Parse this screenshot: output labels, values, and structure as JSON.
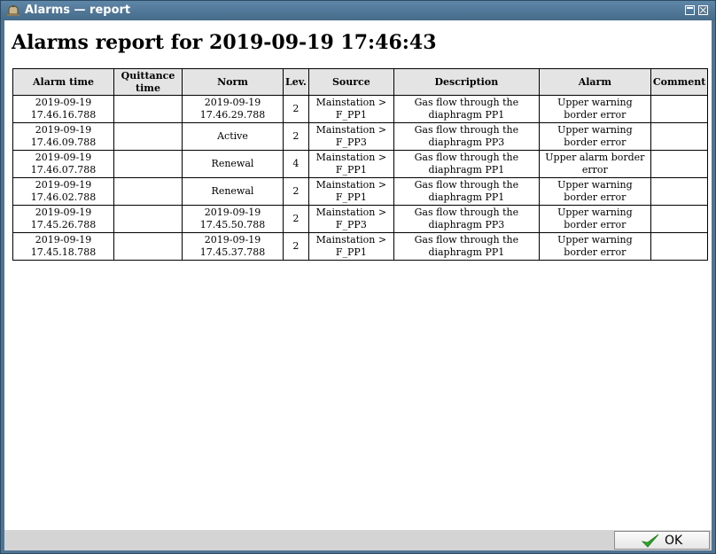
{
  "window": {
    "title": "Alarms — report",
    "icon": "alarm-bell-icon"
  },
  "report": {
    "title": "Alarms report for 2019-09-19 17:46:43",
    "columns": [
      "Alarm time",
      "Quittance time",
      "Norm",
      "Lev.",
      "Source",
      "Description",
      "Alarm",
      "Comment"
    ],
    "rows": [
      [
        "2019-09-19 17.46.16.788",
        "",
        "2019-09-19 17.46.29.788",
        "2",
        "Mainstation > F_PP1",
        "Gas flow through the diaphragm PP1",
        "Upper warning border error",
        ""
      ],
      [
        "2019-09-19 17.46.09.788",
        "",
        "Active",
        "2",
        "Mainstation > F_PP3",
        "Gas flow through the diaphragm PP3",
        "Upper warning border error",
        ""
      ],
      [
        "2019-09-19 17.46.07.788",
        "",
        "Renewal",
        "4",
        "Mainstation > F_PP1",
        "Gas flow through the diaphragm PP1",
        "Upper alarm border error",
        ""
      ],
      [
        "2019-09-19 17.46.02.788",
        "",
        "Renewal",
        "2",
        "Mainstation > F_PP1",
        "Gas flow through the diaphragm PP1",
        "Upper warning border error",
        ""
      ],
      [
        "2019-09-19 17.45.26.788",
        "",
        "2019-09-19 17.45.50.788",
        "2",
        "Mainstation > F_PP3",
        "Gas flow through the diaphragm PP3",
        "Upper warning border error",
        ""
      ],
      [
        "2019-09-19 17.45.18.788",
        "",
        "2019-09-19 17.45.37.788",
        "2",
        "Mainstation > F_PP1",
        "Gas flow through the diaphragm PP1",
        "Upper warning border error",
        ""
      ]
    ]
  },
  "footer": {
    "ok_label": "OK",
    "ok_icon": "checkmark-icon",
    "ok_icon_color": "#2fa52b"
  }
}
